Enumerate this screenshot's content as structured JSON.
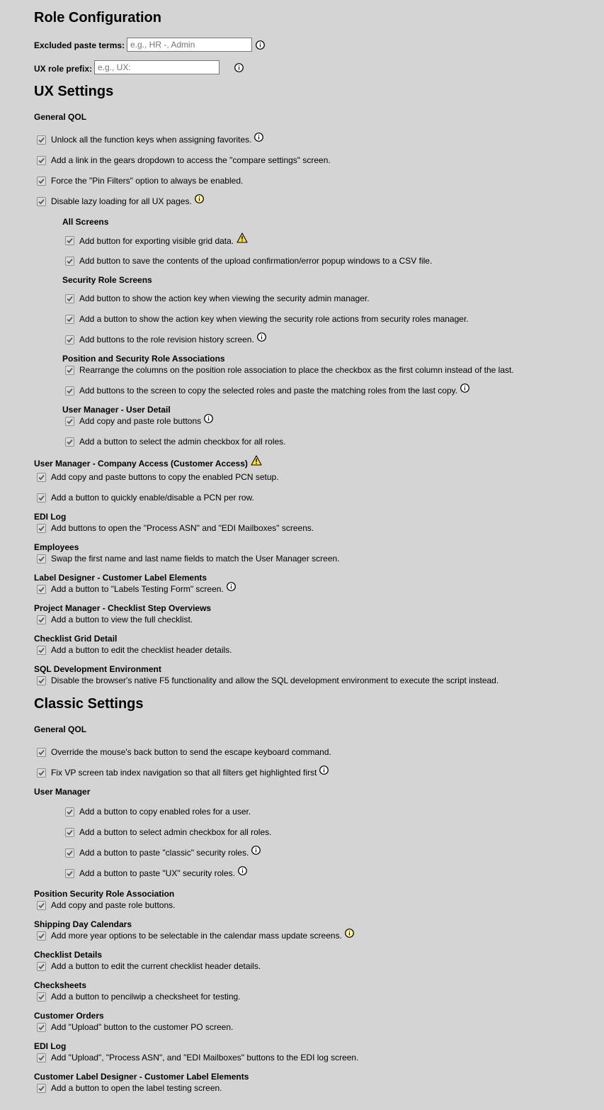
{
  "role_config": {
    "title": "Role Configuration",
    "excluded_label": "Excluded paste terms:",
    "excluded_placeholder": "e.g., HR -, Admin",
    "excluded_value": "",
    "prefix_label": "UX role prefix:",
    "prefix_placeholder": "e.g., UX:",
    "prefix_value": ""
  },
  "ux": {
    "title": "UX Settings",
    "general_qol": "General QOL",
    "opt_fkeys": "Unlock all the function keys when assigning favorites.",
    "opt_gears": "Add a link in the gears dropdown to access the \"compare settings\" screen.",
    "opt_pin": "Force the \"Pin Filters\" option to always be enabled.",
    "opt_lazy": "Disable lazy loading for all UX pages.",
    "all_screens": "All Screens",
    "opt_export": "Add button for exporting visible grid data.",
    "opt_popup_csv": "Add button to save the contents of the upload confirmation/error popup windows to a CSV file.",
    "security_role_screens": "Security Role Screens",
    "opt_action_key_admin": "Add button to show the action key when viewing the security admin manager.",
    "opt_action_key_roles": "Add a button to show the action key when viewing the security role actions from security roles manager.",
    "opt_revision": "Add buttons to the role revision history screen.",
    "pos_sec_assoc": "Position and Security Role Associations",
    "opt_rearrange": "Rearrange the columns on the position role association to place the checkbox as the first column instead of the last.",
    "opt_copy_paste_roles": "Add buttons to the screen to copy the selected roles and paste the matching roles from the last copy.",
    "user_detail": "User Manager - User Detail",
    "opt_copy_paste_btns": "Add copy and paste role buttons",
    "opt_admin_all": "Add a button to select the admin checkbox for all roles.",
    "company_access": "User Manager - Company Access (Customer Access)",
    "opt_pcn_copy": "Add copy and paste buttons to copy the enabled PCN setup.",
    "opt_pcn_toggle": "Add a button to quickly enable/disable a PCN per row.",
    "edi_log": "EDI Log",
    "opt_edi": "Add buttons to open the \"Process ASN\" and \"EDI Mailboxes\" screens.",
    "employees": "Employees",
    "opt_swap": "Swap the first name and last name fields to match the User Manager screen.",
    "label_designer": "Label Designer - Customer Label Elements",
    "opt_labels": "Add a button to \"Labels Testing Form\" screen.",
    "project_manager": "Project Manager - Checklist Step Overviews",
    "opt_checklist": "Add a button to view the full checklist.",
    "checklist_grid": "Checklist Grid Detail",
    "opt_checklist_header": "Add a button to edit the checklist header details.",
    "sql_env": "SQL Development Environment",
    "opt_f5": "Disable the browser's native F5 functionality and allow the SQL development environment to execute the script instead."
  },
  "classic": {
    "title": "Classic Settings",
    "general_qol": "General QOL",
    "opt_back": "Override the mouse's back button to send the escape keyboard command.",
    "opt_tab": "Fix VP screen tab index navigation so that all filters get highlighted first",
    "user_manager": "User Manager",
    "opt_copy_roles": "Add a button to copy enabled roles for a user.",
    "opt_admin": "Add a button to select admin checkbox for all roles.",
    "opt_paste_classic": "Add a button to paste \"classic\" security roles.",
    "opt_paste_ux": "Add a button to paste \"UX\" security roles.",
    "pos_sec_assoc": "Position Security Role Association",
    "opt_pos_copy": "Add copy and paste role buttons.",
    "shipping": "Shipping Day Calendars",
    "opt_year": "Add more year options to be selectable in the calendar mass update screens.",
    "checklist_details": "Checklist Details",
    "opt_checklist_edit": "Add a button to edit the current checklist header details.",
    "checksheets": "Checksheets",
    "opt_pencilwip": "Add a button to pencilwip a checksheet for testing.",
    "customer_orders": "Customer Orders",
    "opt_upload": "Add \"Upload\" button to the customer PO screen.",
    "edi_log": "EDI Log",
    "opt_edi": "Add \"Upload\", \"Process ASN\", and \"EDI Mailboxes\" buttons to the EDI log screen.",
    "label_designer": "Customer Label Designer - Customer Label Elements",
    "opt_label_test": "Add a button to open the label testing screen."
  },
  "colors": {
    "background": "#d4d4d4",
    "info_fill": "#ffffff",
    "info_yellow": "#fff3a0",
    "warning_yellow": "#ffe13a"
  }
}
